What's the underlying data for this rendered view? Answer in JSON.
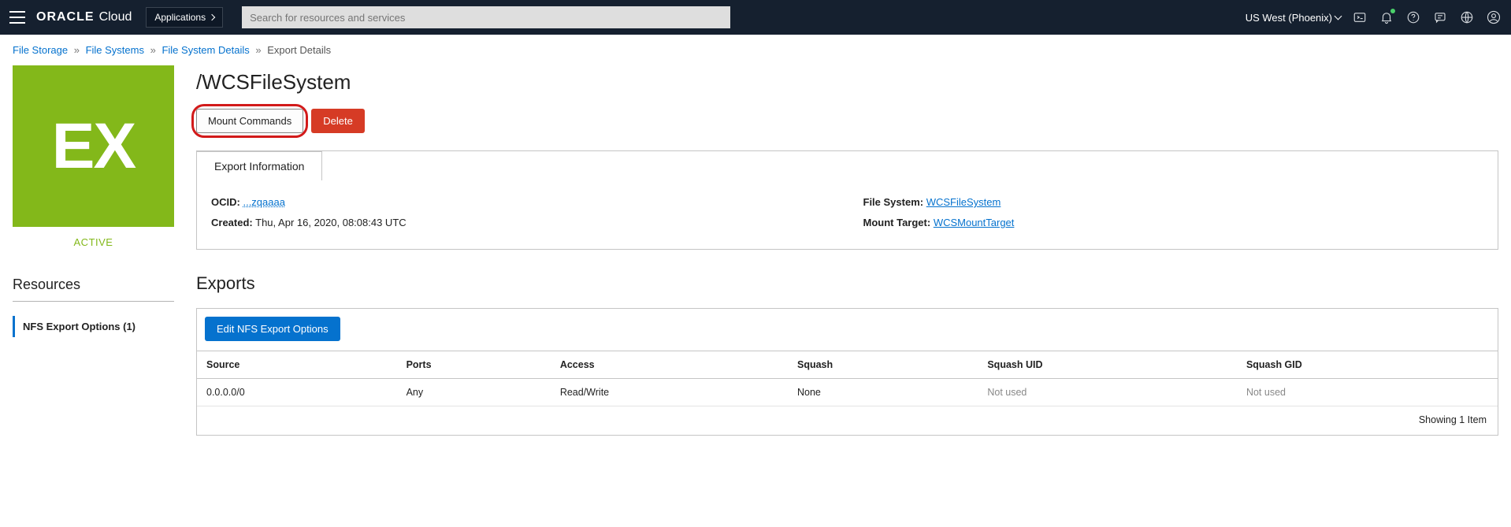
{
  "header": {
    "brand_bold": "ORACLE",
    "brand_light": "Cloud",
    "applications_label": "Applications",
    "search_placeholder": "Search for resources and services",
    "region": "US West (Phoenix)"
  },
  "breadcrumb": {
    "items": [
      {
        "label": "File Storage",
        "link": true
      },
      {
        "label": "File Systems",
        "link": true
      },
      {
        "label": "File System Details",
        "link": true
      },
      {
        "label": "Export Details",
        "link": false
      }
    ]
  },
  "resource": {
    "icon_text": "EX",
    "status": "ACTIVE",
    "title": "/WCSFileSystem"
  },
  "actions": {
    "mount_commands": "Mount Commands",
    "delete": "Delete"
  },
  "tab": {
    "label": "Export Information",
    "ocid_label": "OCID:",
    "ocid_value": "...zqaaaa",
    "created_label": "Created:",
    "created_value": "Thu, Apr 16, 2020, 08:08:43 UTC",
    "fs_label": "File System:",
    "fs_value": "WCSFileSystem",
    "mt_label": "Mount Target:",
    "mt_value": "WCSMountTarget"
  },
  "left": {
    "resources_heading": "Resources",
    "nfs_item": "NFS Export Options (1)"
  },
  "exports": {
    "heading": "Exports",
    "edit_button": "Edit NFS Export Options",
    "columns": [
      "Source",
      "Ports",
      "Access",
      "Squash",
      "Squash UID",
      "Squash GID"
    ],
    "rows": [
      {
        "source": "0.0.0.0/0",
        "ports": "Any",
        "access": "Read/Write",
        "squash": "None",
        "squash_uid": "Not used",
        "squash_gid": "Not used"
      }
    ],
    "footer": "Showing 1 Item"
  }
}
